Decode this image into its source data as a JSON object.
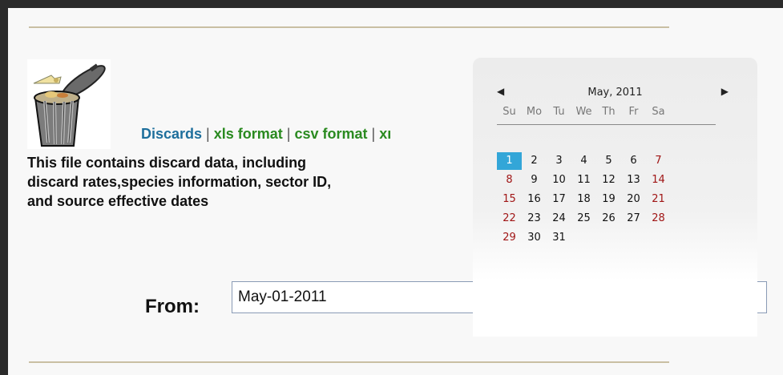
{
  "links": {
    "discards": "Discards",
    "sep": " | ",
    "xls": "xls format",
    "csv": "csv format",
    "xml_partial": "xı"
  },
  "description": "This file contains discard data, including discard rates,species information, sector ID, and source effective dates",
  "from": {
    "label": "From:",
    "value": "May-01-2011"
  },
  "calendar": {
    "title": "May, 2011",
    "prev": "◀",
    "next": "▶",
    "weekdays": [
      "Su",
      "Mo",
      "Tu",
      "We",
      "Th",
      "Fr",
      "Sa"
    ],
    "weeks": [
      [
        "",
        "",
        "",
        "",
        "",
        "",
        ""
      ],
      [
        "1",
        "2",
        "3",
        "4",
        "5",
        "6",
        "7"
      ],
      [
        "8",
        "9",
        "10",
        "11",
        "12",
        "13",
        "14"
      ],
      [
        "15",
        "16",
        "17",
        "18",
        "19",
        "20",
        "21"
      ],
      [
        "22",
        "23",
        "24",
        "25",
        "26",
        "27",
        "28"
      ],
      [
        "29",
        "30",
        "31",
        "",
        "",
        "",
        ""
      ]
    ],
    "selected": "1"
  },
  "colors": {
    "accent": "#33a6d8",
    "weekend": "#a01515",
    "link": "#1e6f9c",
    "format_link": "#2a8a20"
  }
}
